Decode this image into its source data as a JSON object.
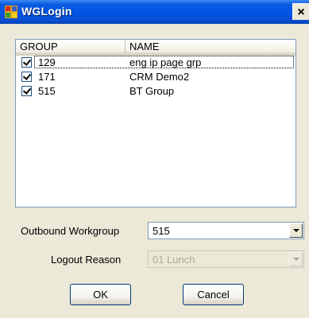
{
  "window": {
    "title": "WGLogin",
    "app_icon": "window-app-icon",
    "close_label": "×"
  },
  "list": {
    "columns": [
      "GROUP",
      "NAME"
    ],
    "rows": [
      {
        "group": "129",
        "name": "eng ip page grp",
        "checked": true
      },
      {
        "group": "171",
        "name": "CRM Demo2",
        "checked": true
      },
      {
        "group": "515",
        "name": "BT Group",
        "checked": true
      }
    ]
  },
  "outbound": {
    "label": "Outbound Workgroup",
    "value": "515"
  },
  "logout": {
    "label": "Logout Reason",
    "value": "01 Lunch",
    "disabled": true
  },
  "buttons": {
    "ok": "OK",
    "cancel": "Cancel"
  },
  "colors": {
    "titlebar": "#0054e3",
    "dialog_bg": "#ece9d8"
  }
}
